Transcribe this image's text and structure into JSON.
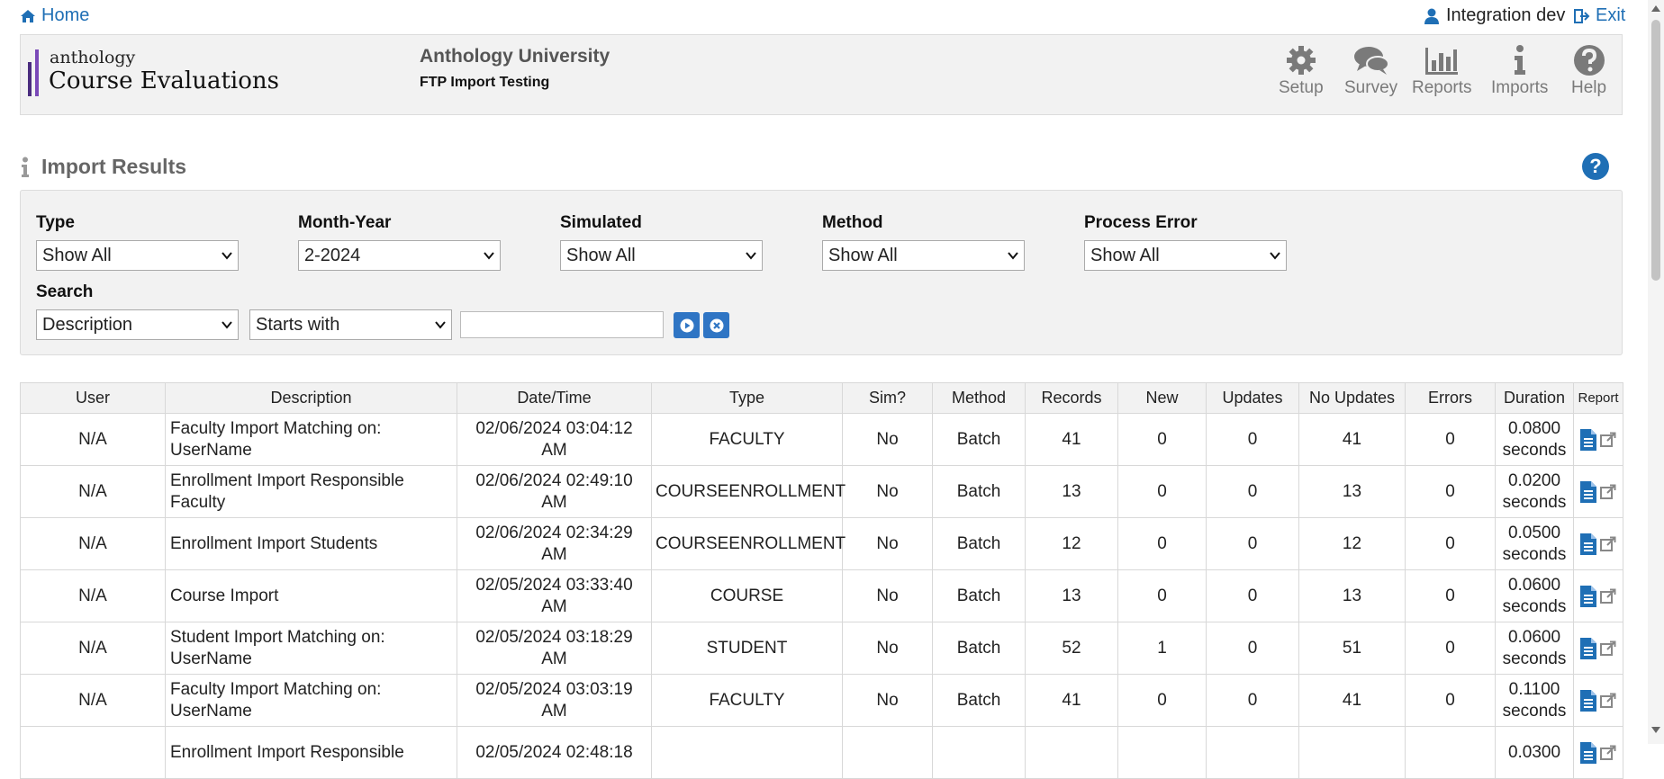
{
  "topbar": {
    "home": "Home",
    "user": "Integration dev",
    "exit": "Exit"
  },
  "header": {
    "logo_small": "anthology",
    "logo_big": "Course Evaluations",
    "org": "Anthology University",
    "suborg": "FTP Import Testing",
    "nav": [
      "Setup",
      "Survey",
      "Reports",
      "Imports",
      "Help"
    ]
  },
  "section": {
    "title": "Import Results"
  },
  "filters": {
    "type_label": "Type",
    "type_value": "Show All",
    "month_label": "Month-Year",
    "month_value": "2-2024",
    "sim_label": "Simulated",
    "sim_value": "Show All",
    "method_label": "Method",
    "method_value": "Show All",
    "error_label": "Process Error",
    "error_value": "Show All",
    "search_label": "Search",
    "search_field": "Description",
    "search_op": "Starts with",
    "search_text": ""
  },
  "table": {
    "headers": [
      "User",
      "Description",
      "Date/Time",
      "Type",
      "Sim?",
      "Method",
      "Records",
      "New",
      "Updates",
      "No Updates",
      "Errors",
      "Duration",
      "Report"
    ],
    "rows": [
      {
        "user": "N/A",
        "desc1": "Faculty Import Matching on:",
        "desc2": "UserName",
        "dt1": "02/06/2024 03:04:12",
        "dt2": "AM",
        "type": "FACULTY",
        "sim": "No",
        "method": "Batch",
        "records": "41",
        "new": "0",
        "updates": "0",
        "noupdates": "41",
        "errors": "0",
        "dur1": "0.0800",
        "dur2": "seconds"
      },
      {
        "user": "N/A",
        "desc1": "Enrollment Import Responsible",
        "desc2": "Faculty",
        "dt1": "02/06/2024 02:49:10",
        "dt2": "AM",
        "type": "COURSEENROLLMENT",
        "sim": "No",
        "method": "Batch",
        "records": "13",
        "new": "0",
        "updates": "0",
        "noupdates": "13",
        "errors": "0",
        "dur1": "0.0200",
        "dur2": "seconds"
      },
      {
        "user": "N/A",
        "desc1": "Enrollment Import Students",
        "desc2": "",
        "dt1": "02/06/2024 02:34:29",
        "dt2": "AM",
        "type": "COURSEENROLLMENT",
        "sim": "No",
        "method": "Batch",
        "records": "12",
        "new": "0",
        "updates": "0",
        "noupdates": "12",
        "errors": "0",
        "dur1": "0.0500",
        "dur2": "seconds"
      },
      {
        "user": "N/A",
        "desc1": "Course Import",
        "desc2": "",
        "dt1": "02/05/2024 03:33:40",
        "dt2": "AM",
        "type": "COURSE",
        "sim": "No",
        "method": "Batch",
        "records": "13",
        "new": "0",
        "updates": "0",
        "noupdates": "13",
        "errors": "0",
        "dur1": "0.0600",
        "dur2": "seconds"
      },
      {
        "user": "N/A",
        "desc1": "Student Import Matching on:",
        "desc2": "UserName",
        "dt1": "02/05/2024 03:18:29",
        "dt2": "AM",
        "type": "STUDENT",
        "sim": "No",
        "method": "Batch",
        "records": "52",
        "new": "1",
        "updates": "0",
        "noupdates": "51",
        "errors": "0",
        "dur1": "0.0600",
        "dur2": "seconds"
      },
      {
        "user": "N/A",
        "desc1": "Faculty Import Matching on:",
        "desc2": "UserName",
        "dt1": "02/05/2024 03:03:19",
        "dt2": "AM",
        "type": "FACULTY",
        "sim": "No",
        "method": "Batch",
        "records": "41",
        "new": "0",
        "updates": "0",
        "noupdates": "41",
        "errors": "0",
        "dur1": "0.1100",
        "dur2": "seconds"
      },
      {
        "user": "",
        "desc1": "Enrollment Import Responsible",
        "desc2": "",
        "dt1": "02/05/2024 02:48:18",
        "dt2": "",
        "type": "",
        "sim": "",
        "method": "",
        "records": "",
        "new": "",
        "updates": "",
        "noupdates": "",
        "errors": "",
        "dur1": "0.0300",
        "dur2": ""
      }
    ]
  },
  "colors": {
    "link": "#1f6fb5",
    "button": "#2f75c4",
    "panel": "#f2f2f2"
  }
}
